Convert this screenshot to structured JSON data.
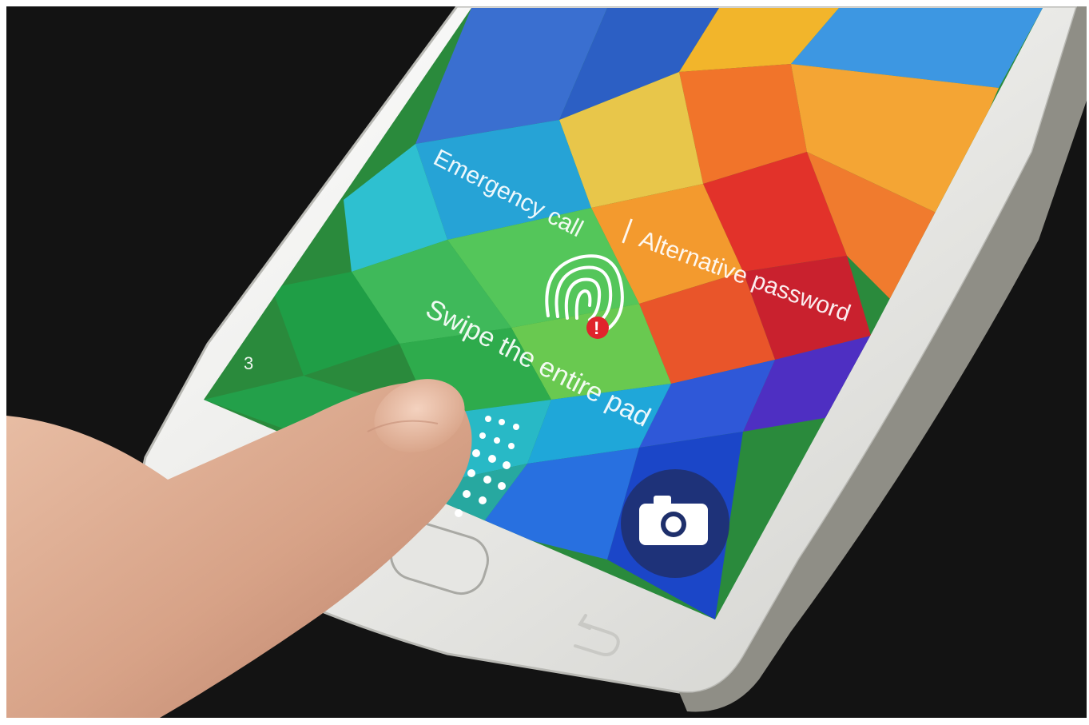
{
  "lock_screen": {
    "emergency_call": "Emergency call",
    "separator": "|",
    "alternative_password": "Alternative password",
    "instruction": "Swipe the entire pad",
    "attempt_counter": "3",
    "warning_glyph": "!"
  },
  "icons": {
    "fingerprint": "fingerprint-icon",
    "warning": "warning-icon",
    "camera": "camera-icon",
    "recent_apps": "recent-apps-icon",
    "back": "back-icon",
    "home": "home-button"
  },
  "colors": {
    "phone_body": "#f2f2f0",
    "background": "#141414",
    "warning_red": "#e0242c",
    "camera_shortcut_bg": "#1e2f6b"
  }
}
